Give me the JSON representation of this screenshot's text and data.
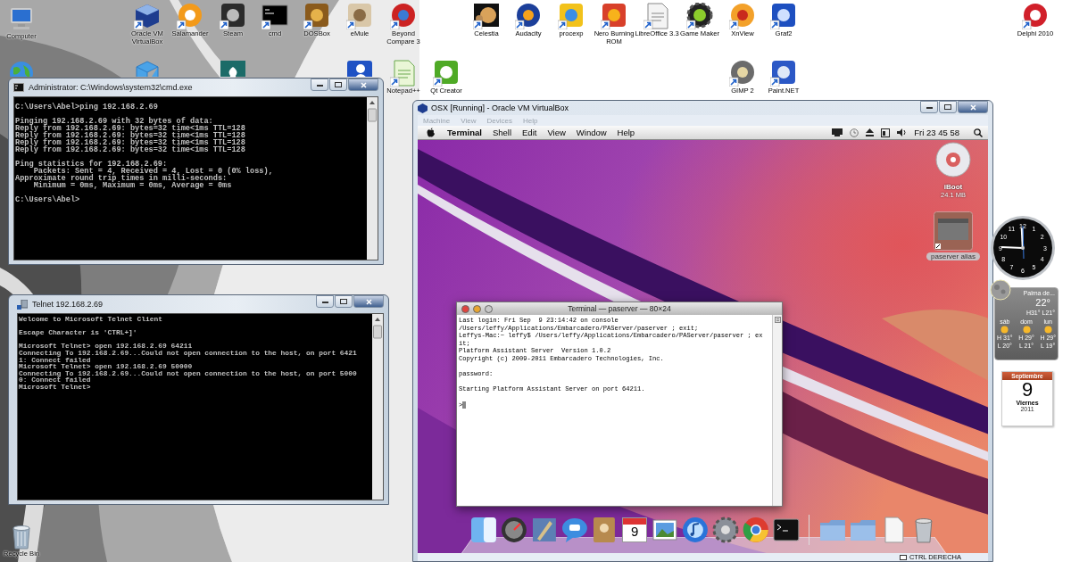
{
  "desktop_icons": [
    {
      "label": "Computer"
    },
    {
      "label": "Oracle VM VirtualBox"
    },
    {
      "label": "Salamander"
    },
    {
      "label": "Steam"
    },
    {
      "label": "cmd"
    },
    {
      "label": "DOSBox"
    },
    {
      "label": "eMule"
    },
    {
      "label": "Beyond Compare 3"
    },
    {
      "label": "Celestia"
    },
    {
      "label": "Audacity"
    },
    {
      "label": "procexp"
    },
    {
      "label": "Nero Burning ROM"
    },
    {
      "label": "LibreOffice 3.3"
    },
    {
      "label": "Game Maker"
    },
    {
      "label": "XnView"
    },
    {
      "label": "Graf2"
    },
    {
      "label": "Delphi 2010"
    },
    {
      "label": "Notepad++"
    },
    {
      "label": "Qt Creator"
    },
    {
      "label": "GIMP 2"
    },
    {
      "label": "Paint.NET"
    },
    {
      "label": "Recycle Bin"
    }
  ],
  "cmd_window": {
    "kind": "command_prompt",
    "title": "Administrator: C:\\Windows\\system32\\cmd.exe",
    "blocks": [
      [
        "C:\\Users\\Abel>ping 192.168.2.69"
      ],
      [
        "Pinging 192.168.2.69 with 32 bytes of data:",
        "Reply from 192.168.2.69: bytes=32 time<1ms TTL=128",
        "Reply from 192.168.2.69: bytes=32 time<1ms TTL=128",
        "Reply from 192.168.2.69: bytes=32 time<1ms TTL=128",
        "Reply from 192.168.2.69: bytes=32 time<1ms TTL=128"
      ],
      [
        "Ping statistics for 192.168.2.69:",
        "    Packets: Sent = 4, Received = 4, Lost = 0 (0% loss),",
        "Approximate round trip times in milli-seconds:",
        "    Minimum = 0ms, Maximum = 0ms, Average = 0ms"
      ],
      [
        "C:\\Users\\Abel>"
      ]
    ]
  },
  "telnet_window": {
    "kind": "telnet",
    "title": "Telnet 192.168.2.69",
    "blocks": [
      [
        "Welcome to Microsoft Telnet Client"
      ],
      [
        "Escape Character is 'CTRL+]'"
      ],
      [
        "Microsoft Telnet> open 192.168.2.69 64211",
        "Connecting To 192.168.2.69...Could not open connection to the host, on port 6421",
        "1: Connect failed",
        "Microsoft Telnet> open 192.168.2.69 50000",
        "Connecting To 192.168.2.69...Could not open connection to the host, on port 5000",
        "0: Connect failed",
        "Microsoft Telnet>"
      ]
    ]
  },
  "virtualbox": {
    "title": "OSX [Running] - Oracle VM VirtualBox",
    "menu": [
      {
        "label": "Machine",
        "disabled": true
      },
      {
        "label": "View",
        "disabled": true
      },
      {
        "label": "Devices",
        "disabled": true
      },
      {
        "label": "Help",
        "disabled": true
      }
    ],
    "mac": {
      "menu": [
        {
          "label": "Terminal",
          "kind": "app"
        },
        {
          "label": "Shell",
          "kind": "menu"
        },
        {
          "label": "Edit",
          "kind": "menu"
        },
        {
          "label": "View",
          "kind": "menu"
        },
        {
          "label": "Window",
          "kind": "menu"
        },
        {
          "label": "Help",
          "kind": "menu"
        }
      ],
      "clock": "Fri 23 45 58",
      "desktop_items": [
        {
          "kind": "disc",
          "label": "iBoot",
          "detail": "24.1 MB"
        },
        {
          "kind": "alias",
          "label": "paserver alias"
        }
      ],
      "terminal": {
        "title": "Terminal — paserver — 80×24",
        "blocks": [
          [
            "Last login: Fri Sep  9 23:14:42 on console",
            "/Users/leffy/Applications/Embarcadero/PAServer/paserver ; exit;",
            "Leffys-Mac:~ leffy$ /Users/leffy/Applications/Embarcadero/PAServer/paserver ; ex",
            "it;",
            "Platform Assistant Server  Version 1.0.2",
            "Copyright (c) 2009-2011 Embarcadero Technologies, Inc."
          ],
          [
            "password:"
          ],
          [
            "Starting Platform Assistant Server on port 64211."
          ],
          [
            ">"
          ]
        ]
      },
      "dock": {
        "calendar_day": "9"
      }
    },
    "status_bar": {
      "host_key": "CTRL DERECHA"
    }
  },
  "gadgets": {
    "clock": {
      "numerals": [
        "12",
        "1",
        "2",
        "3",
        "4",
        "5",
        "6",
        "7",
        "8",
        "9",
        "10",
        "11"
      ]
    },
    "weather": {
      "location": "Palma de...",
      "temperature": "22°",
      "range": "H31° L21°",
      "days": [
        {
          "day": "sáb",
          "high": "H 31°",
          "low": "L 20°"
        },
        {
          "day": "dom",
          "high": "H 29°",
          "low": "L 21°"
        },
        {
          "day": "lun",
          "high": "H 29°",
          "low": "L 19°"
        }
      ]
    },
    "calendar": {
      "month": "Septiembre",
      "day": "9",
      "weekday": "Viernes",
      "year": "2011"
    }
  }
}
